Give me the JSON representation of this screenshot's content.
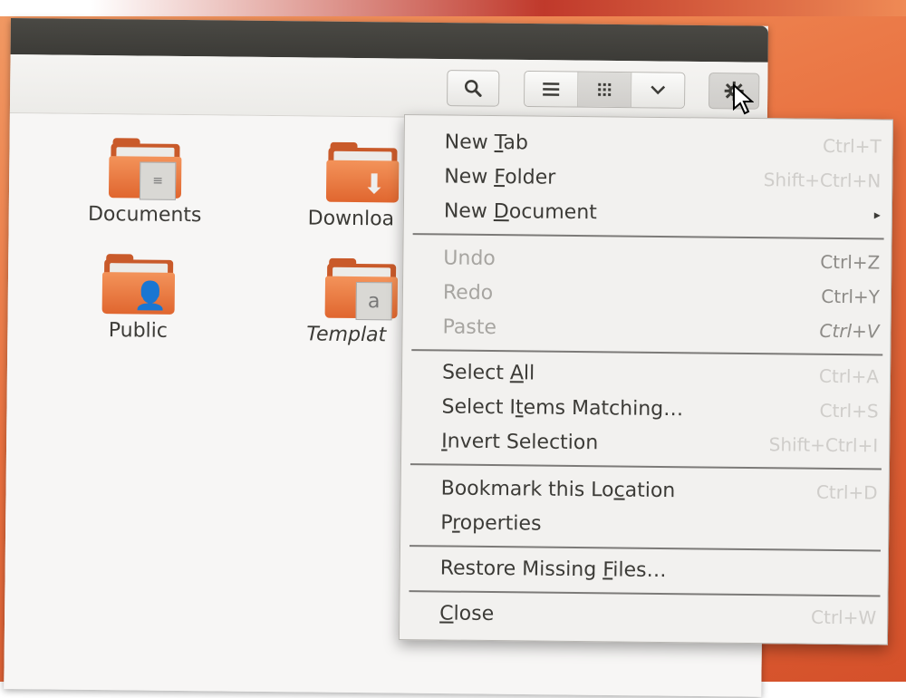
{
  "toolbar": {
    "search_icon": "search-icon",
    "list_view_icon": "list-view-icon",
    "grid_view_icon": "grid-view-icon",
    "view_options_icon": "chevron-down-icon",
    "gear_icon": "gear-icon"
  },
  "folders": [
    {
      "label": "Documents"
    },
    {
      "label": "Downloa"
    },
    {
      "label": "Public"
    },
    {
      "label": "Templat"
    }
  ],
  "menu": {
    "items": [
      {
        "pre": "New ",
        "u": "T",
        "post": "ab",
        "accel": "Ctrl+T",
        "disabled": false
      },
      {
        "pre": "New ",
        "u": "F",
        "post": "older",
        "accel": "Shift+Ctrl+N",
        "disabled": false
      },
      {
        "pre": "New ",
        "u": "D",
        "post": "ocument",
        "accel": "",
        "submenu": "▸",
        "disabled": false
      },
      {
        "pre": "",
        "u": "",
        "post": "Undo",
        "accel": "Ctrl+Z",
        "disabled": true
      },
      {
        "pre": "",
        "u": "",
        "post": "Redo",
        "accel": "Ctrl+Y",
        "disabled": true
      },
      {
        "pre": "",
        "u": "",
        "post": "Paste",
        "accel": "Ctrl+V",
        "disabled": true
      },
      {
        "pre": "Select ",
        "u": "A",
        "post": "ll",
        "accel": "Ctrl+A",
        "disabled": false
      },
      {
        "pre": "Select I",
        "u": "t",
        "post": "ems Matching…",
        "accel": "Ctrl+S",
        "disabled": false
      },
      {
        "pre": "",
        "u": "I",
        "post": "nvert Selection",
        "accel": "Shift+Ctrl+I",
        "disabled": false
      },
      {
        "pre": "Bookmark this Lo",
        "u": "c",
        "post": "ation",
        "accel": "Ctrl+D",
        "disabled": false
      },
      {
        "pre": "P",
        "u": "r",
        "post": "operties",
        "accel": "",
        "disabled": false
      },
      {
        "pre": "Restore Missing ",
        "u": "F",
        "post": "iles…",
        "accel": "",
        "disabled": false
      },
      {
        "pre": "",
        "u": "C",
        "post": "lose",
        "accel": "Ctrl+W",
        "disabled": false
      }
    ]
  }
}
